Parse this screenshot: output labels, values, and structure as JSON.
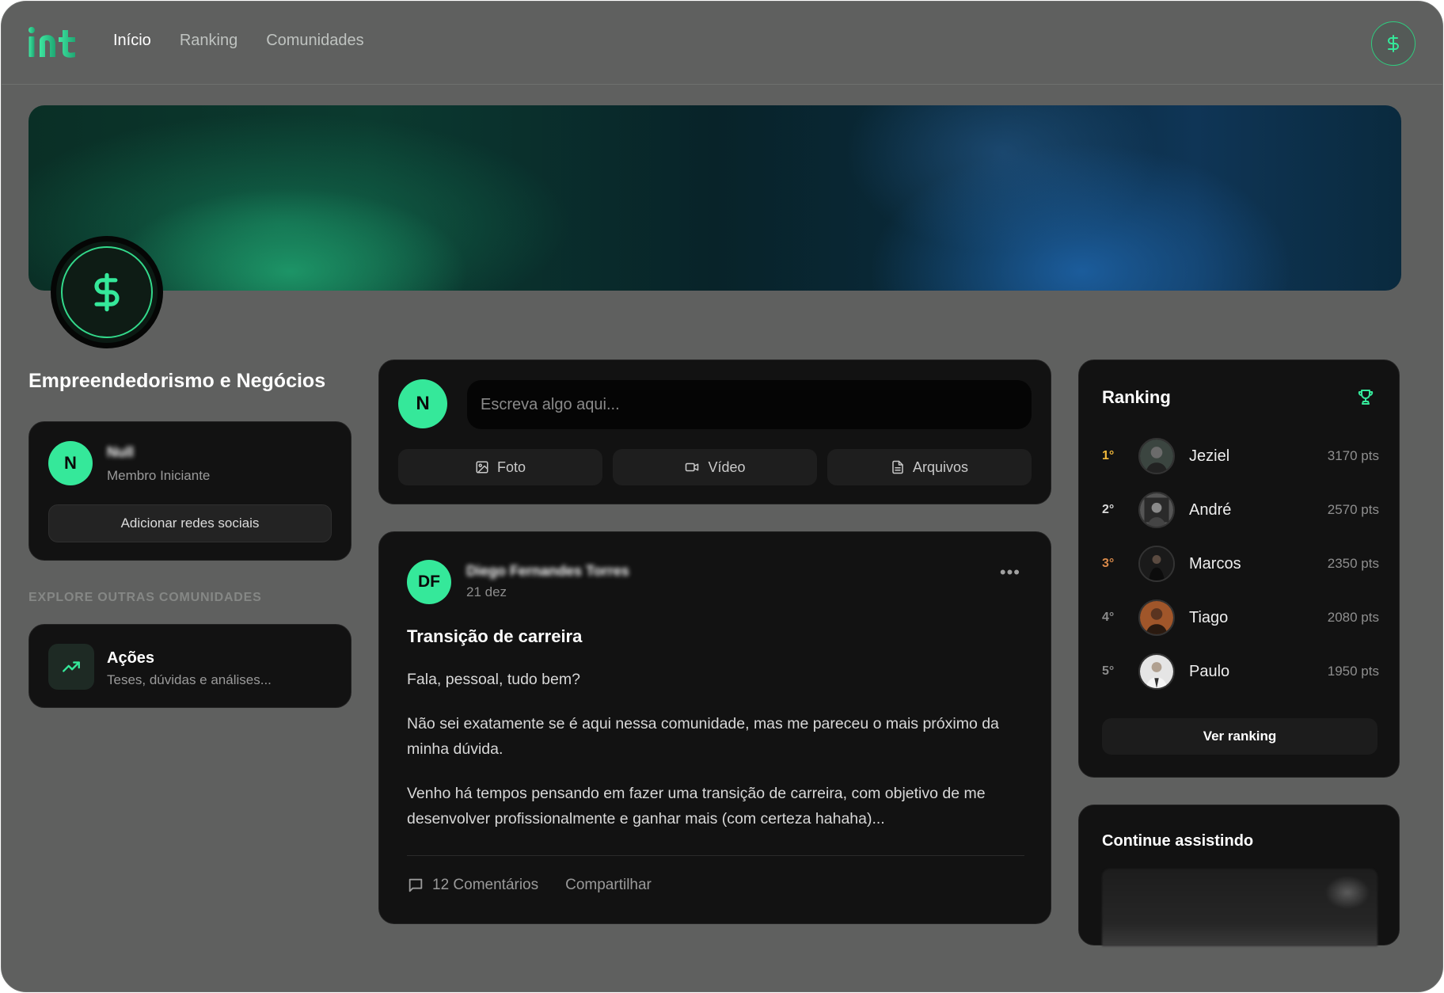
{
  "nav": {
    "logo": "int",
    "items": [
      {
        "label": "Início",
        "active": true
      },
      {
        "label": "Ranking",
        "active": false
      },
      {
        "label": "Comunidades",
        "active": false
      }
    ]
  },
  "community": {
    "name": "Empreendedorismo e Negócios",
    "icon": "dollar-icon"
  },
  "member": {
    "initial": "N",
    "name": "Null",
    "role": "Membro Iniciante",
    "social_button": "Adicionar redes sociais"
  },
  "explore": {
    "label": "EXPLORE OUTRAS COMUNIDADES",
    "items": [
      {
        "title": "Ações",
        "description": "Teses, dúvidas e análises...",
        "icon": "trending-up-icon"
      }
    ]
  },
  "composer": {
    "initial": "N",
    "placeholder": "Escreva algo aqui...",
    "buttons": [
      {
        "label": "Foto",
        "icon": "image-icon"
      },
      {
        "label": "Vídeo",
        "icon": "video-icon"
      },
      {
        "label": "Arquivos",
        "icon": "file-icon"
      }
    ]
  },
  "post": {
    "initials": "DF",
    "author": "Diego Fernandes Torres",
    "date": "21 dez",
    "title": "Transição de carreira",
    "paragraphs": [
      "Fala, pessoal, tudo bem?",
      "Não sei exatamente se é aqui nessa comunidade, mas me pareceu o mais próximo da minha dúvida.",
      "Venho há tempos pensando em fazer uma transição de carreira, com objetivo de me desenvolver profissionalmente e ganhar mais (com certeza hahaha)..."
    ],
    "comments": "12 Comentários",
    "share": "Compartilhar"
  },
  "ranking": {
    "title": "Ranking",
    "button": "Ver ranking",
    "entries": [
      {
        "position": "1°",
        "name": "Jeziel",
        "points": "3170 pts",
        "color": "#f2b93b"
      },
      {
        "position": "2°",
        "name": "André",
        "points": "2570 pts",
        "color": "#d9d9d9"
      },
      {
        "position": "3°",
        "name": "Marcos",
        "points": "2350 pts",
        "color": "#d98a4a"
      },
      {
        "position": "4°",
        "name": "Tiago",
        "points": "2080 pts",
        "color": "#8a8a8a"
      },
      {
        "position": "5°",
        "name": "Paulo",
        "points": "1950 pts",
        "color": "#8a8a8a"
      }
    ]
  },
  "continue": {
    "title": "Continue assistindo"
  },
  "colors": {
    "accent": "#35e89a",
    "card": "#121212",
    "page": "#5f605f"
  }
}
